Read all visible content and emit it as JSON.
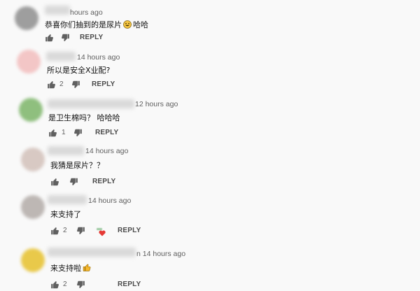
{
  "colors": {
    "avatars": [
      "#9e9e9e",
      "#f3c6c6",
      "#8fbf7e",
      "#d8c9c3",
      "#bdb7b4",
      "#e9c94a"
    ],
    "heart": "#e53935",
    "icon": "#606060"
  },
  "comments": [
    {
      "time": "hours ago",
      "text": "恭喜你们抽到的是尿片",
      "emoji": "grinning-face",
      "text_after": "哈哈",
      "likes": "",
      "reply": "REPLY"
    },
    {
      "time": "14 hours ago",
      "text": "所以是安全X业配?",
      "likes": "2",
      "reply": "REPLY"
    },
    {
      "time": "12 hours ago",
      "text": "是卫生棉吗？ 哈哈哈",
      "likes": "1",
      "reply": "REPLY"
    },
    {
      "time": "14 hours ago",
      "text": "我猜是尿片？？",
      "likes": "",
      "reply": "REPLY"
    },
    {
      "time": "14 hours ago",
      "text": "来支持了",
      "likes": "2",
      "reply": "REPLY",
      "creator_heart": true
    },
    {
      "time": "n 14 hours ago",
      "text": "来支持啦",
      "emoji": "thumbs-up",
      "likes": "2",
      "reply": "REPLY"
    }
  ]
}
